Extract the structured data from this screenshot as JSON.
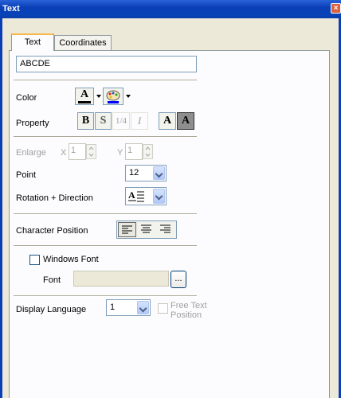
{
  "window": {
    "title": "Text",
    "close_glyph": "×"
  },
  "tabs": [
    {
      "label": "Text"
    },
    {
      "label": "Coordinates"
    }
  ],
  "text_value": "ABCDE",
  "color": {
    "label": "Color",
    "text_color_glyph": "A",
    "icon": "palette-icon"
  },
  "property": {
    "label": "Property",
    "bold": "B",
    "shadow": "S",
    "quarter": "1/4",
    "italic": "I",
    "normal": "A",
    "inverse": "A"
  },
  "enlarge": {
    "label": "Enlarge",
    "x_label": "X",
    "x_value": "1",
    "y_label": "Y",
    "y_value": "1"
  },
  "point": {
    "label": "Point",
    "value": "12"
  },
  "rotation": {
    "label": "Rotation + Direction",
    "icon": "text-direction-icon",
    "glyph": "A"
  },
  "char_position": {
    "label": "Character Position"
  },
  "windows_font": {
    "label": "Windows Font",
    "checked": false,
    "font_label": "Font",
    "font_value": "",
    "browse": "..."
  },
  "display_language": {
    "label": "Display Language",
    "value": "1"
  },
  "free_text": {
    "line1": "Free Text",
    "line2": "Position"
  },
  "colors": {
    "title_bar": "#0a3fb8",
    "close_button": "#d9613d",
    "tab_highlight": "#f7b94b",
    "panel_bg": "#fcfcfe"
  }
}
